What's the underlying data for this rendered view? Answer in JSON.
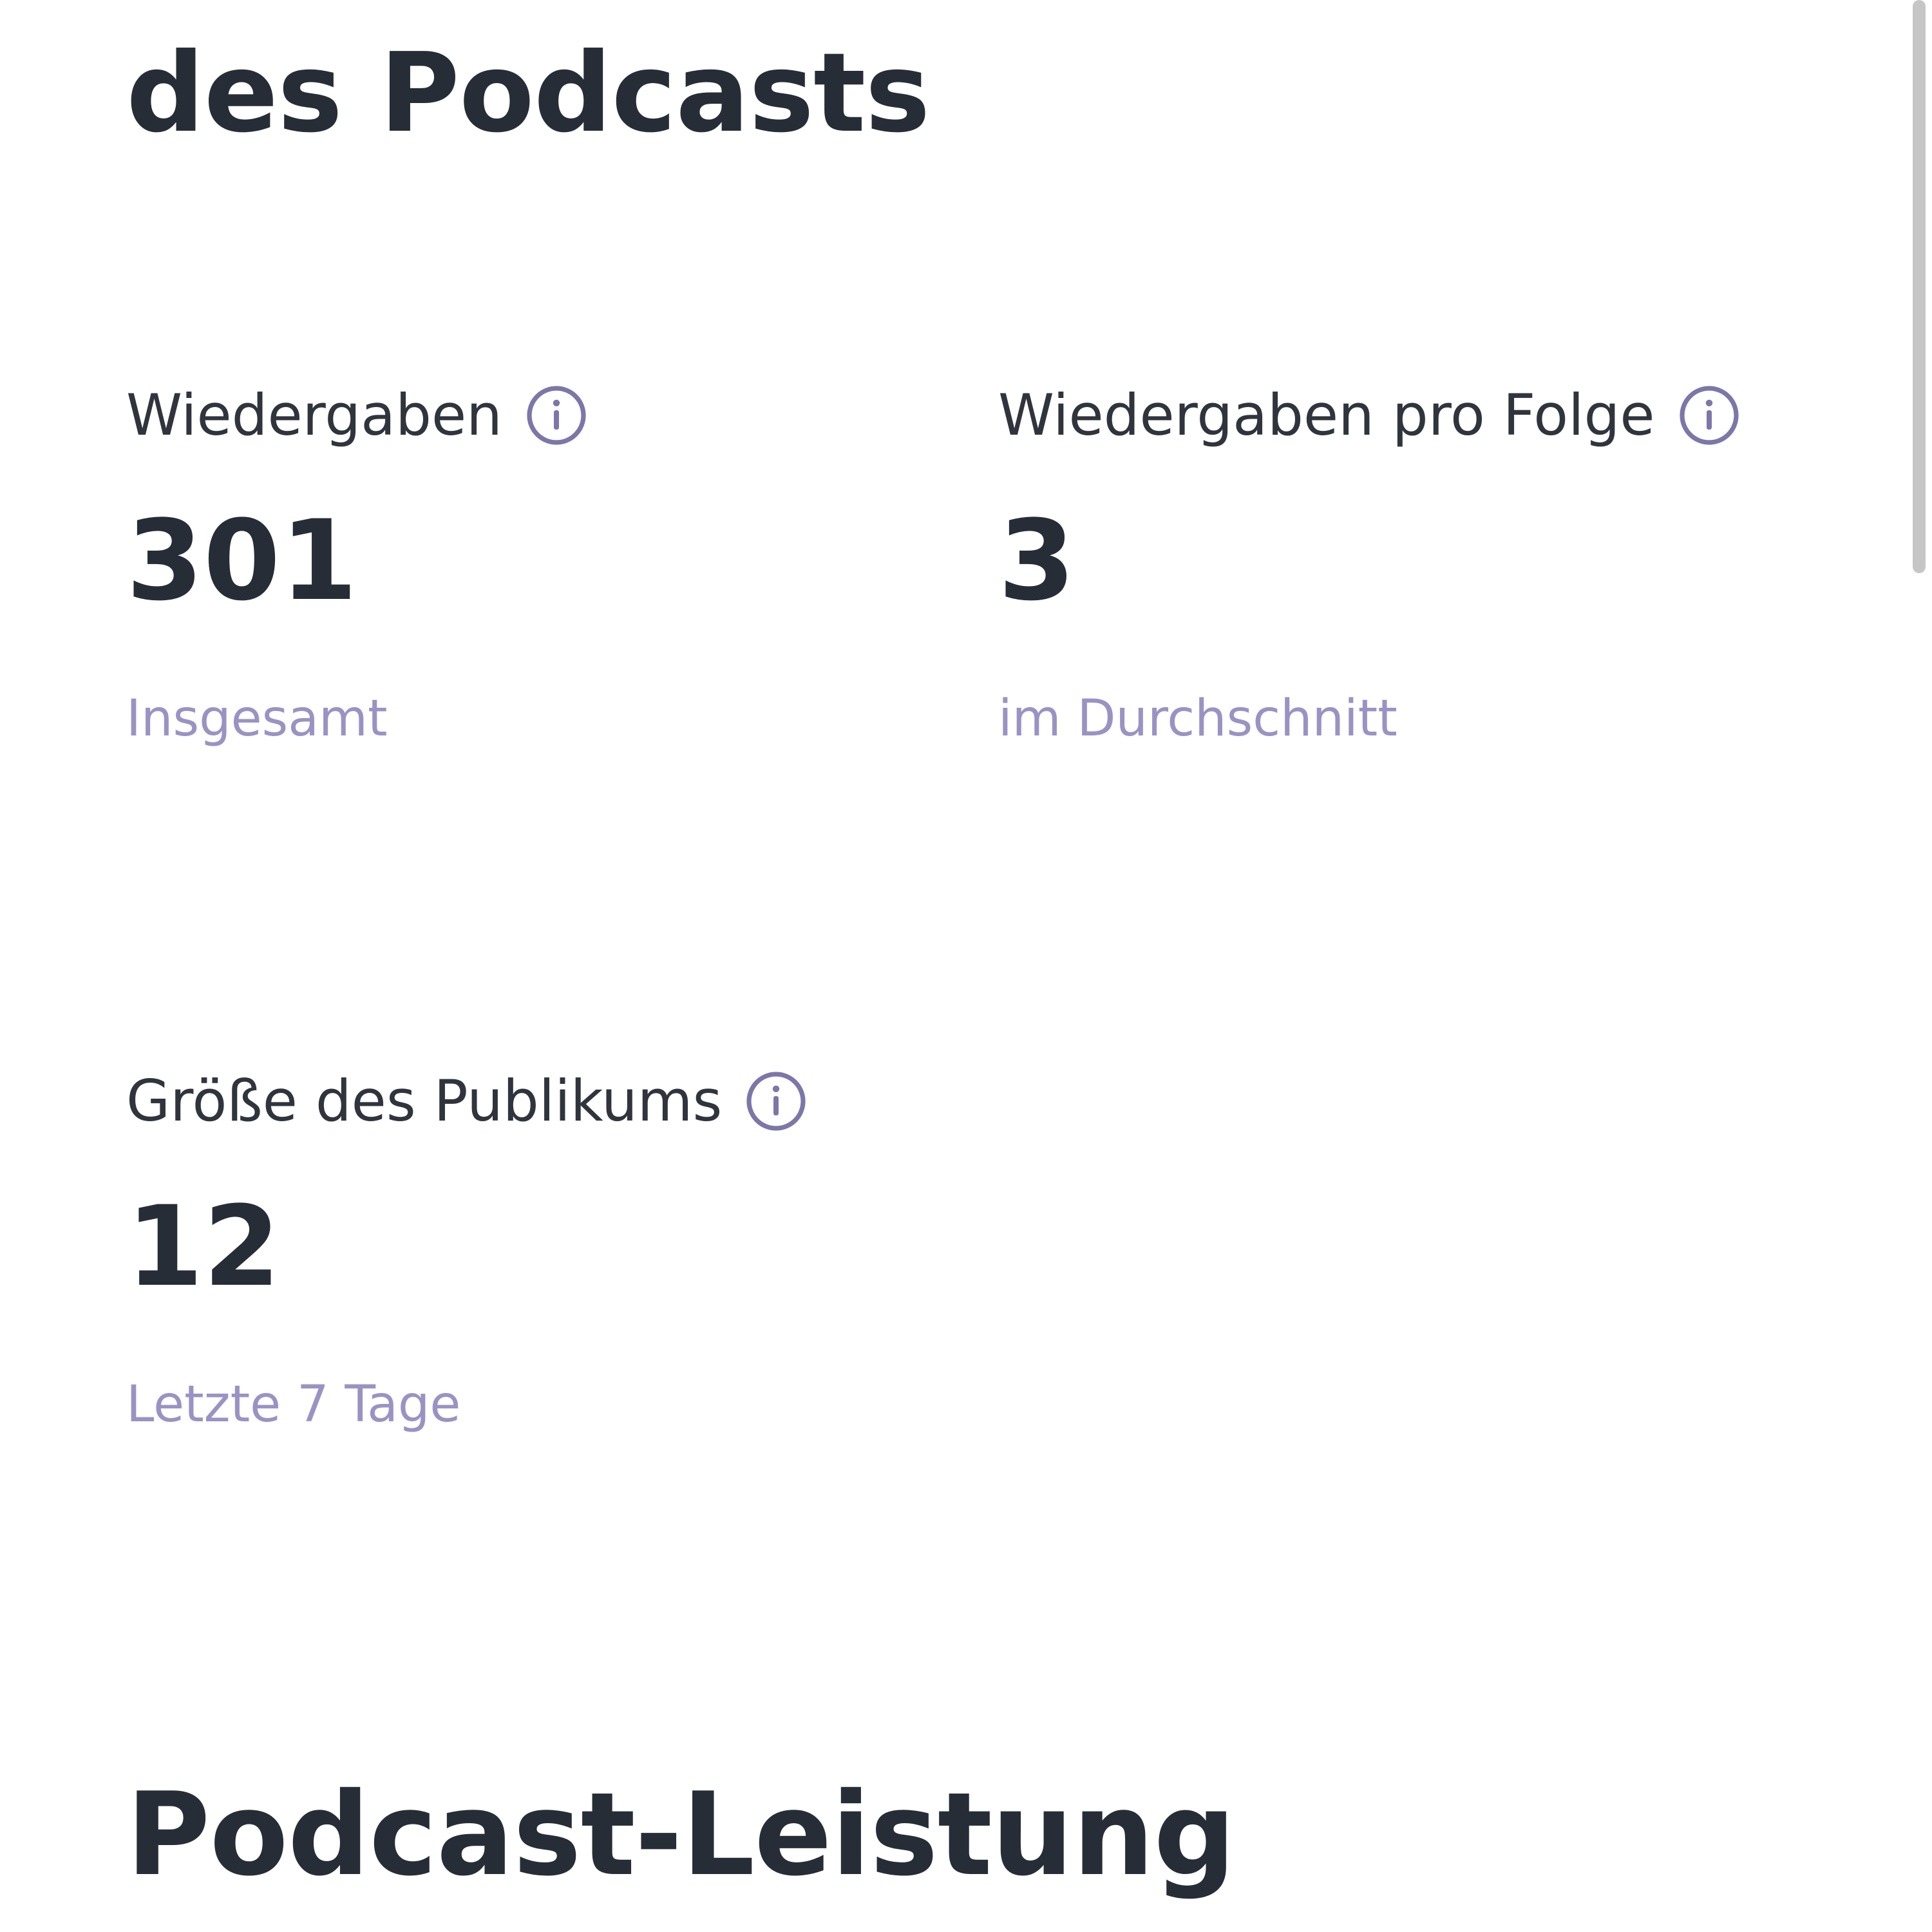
{
  "header": {
    "title": "des Podcasts"
  },
  "stats": [
    {
      "label": "Wiedergaben",
      "value": "301",
      "caption": "Insgesamt"
    },
    {
      "label": "Wiedergaben pro Folge",
      "value": "3",
      "caption": "im Durchschnitt"
    },
    {
      "label": "Größe des Publikums",
      "value": "12",
      "caption": "Letzte 7 Tage"
    }
  ],
  "section": {
    "heading": "Podcast-Leistung"
  },
  "icons": {
    "info": "info-icon"
  },
  "colors": {
    "text_primary": "#272d37",
    "caption": "#9b92c4",
    "icon": "#7d76a8"
  }
}
